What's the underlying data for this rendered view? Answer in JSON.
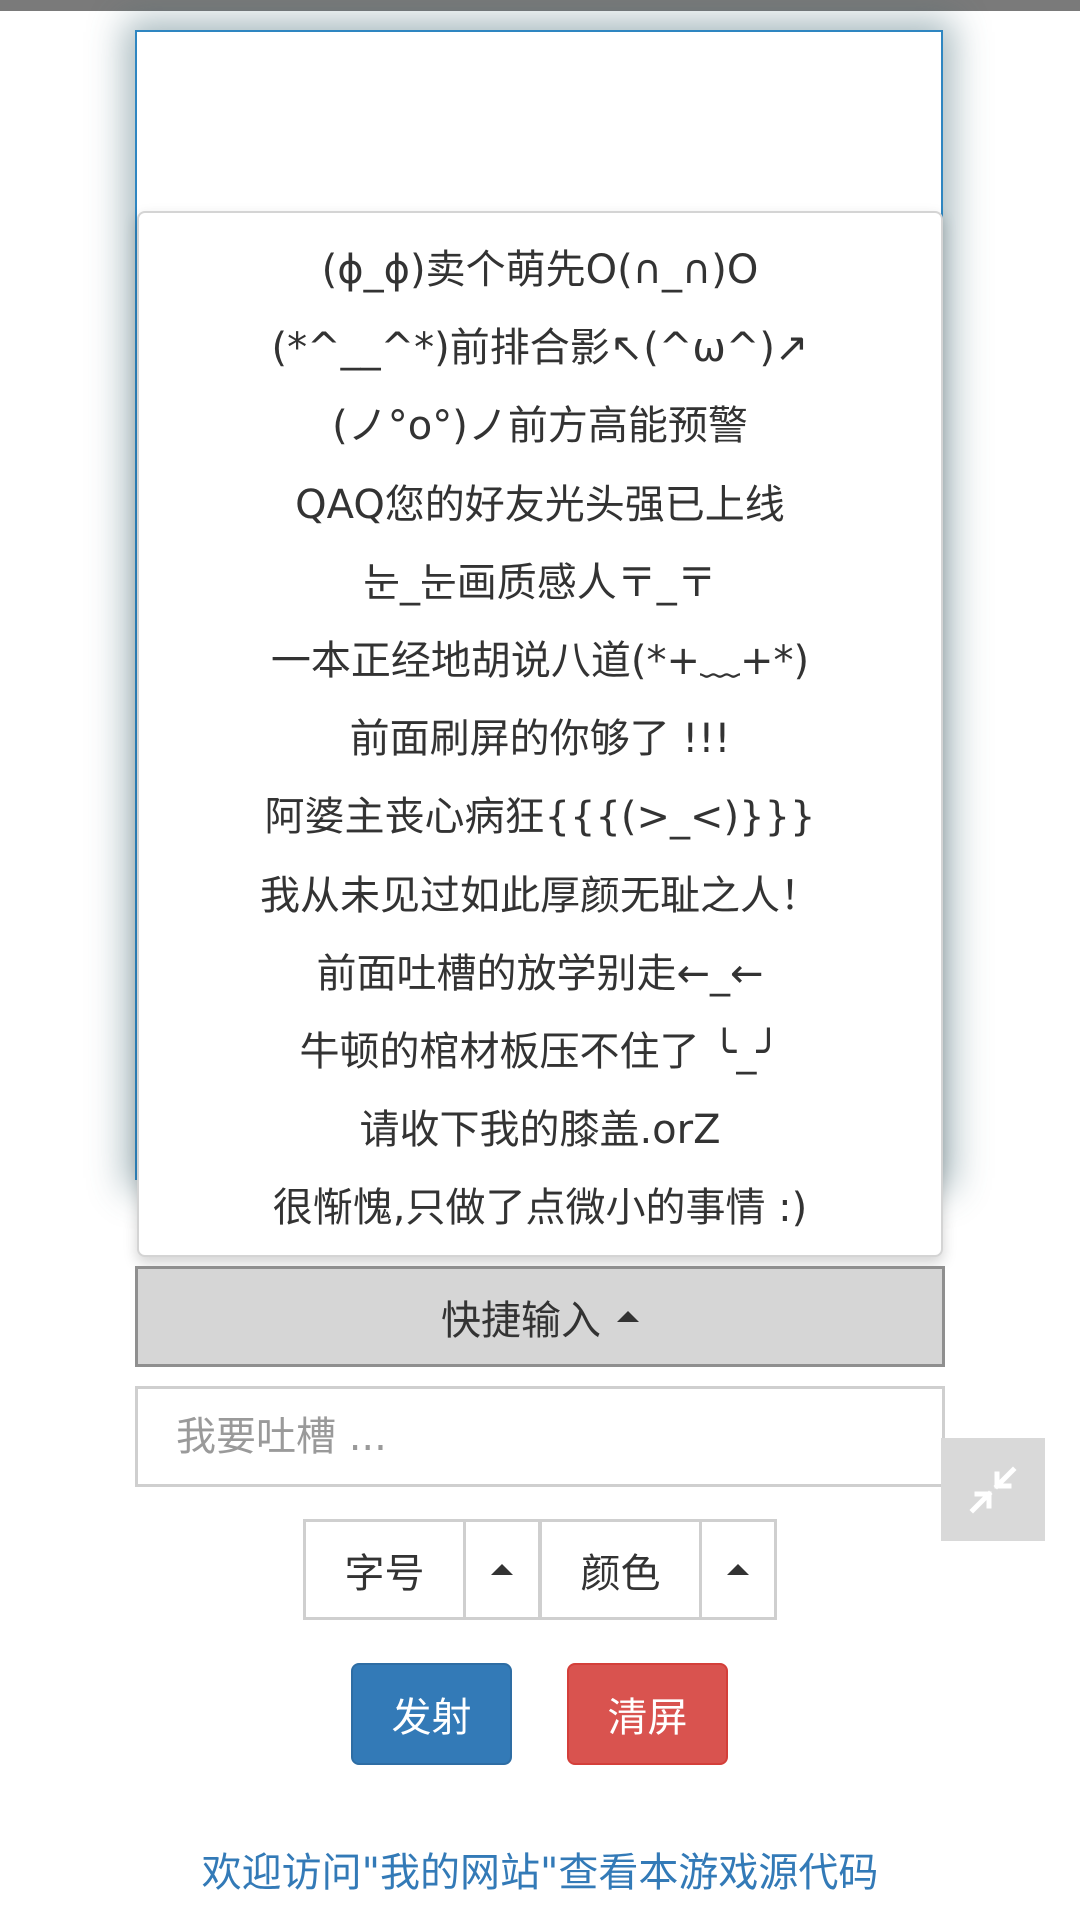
{
  "quick_input": {
    "items": [
      "(ϕ_ϕ)卖个萌先O(∩_∩)O",
      "(*^__^*)前排合影↖(^ω^)↗",
      "(ノ°o°)ノ前方高能预警",
      "QAQ您的好友光头强已上线",
      "눈_눈画质感人〒_〒",
      "一本正经地胡说八道(*+﹏+*)",
      "前面刷屏的你够了 !!!",
      "阿婆主丧心病狂{{{(>_<)}}}",
      "我从未见过如此厚颜无耻之人！",
      "前面吐槽的放学别走←_←",
      "牛顿的棺材板压不住了 ╰_╯",
      "请收下我的膝盖.orZ",
      "很惭愧,只做了点微小的事情 :)"
    ],
    "toggle_label": "快捷输入",
    "toggle_icon": "caret-up-icon"
  },
  "comment": {
    "value": "",
    "placeholder": "我要吐槽 ..."
  },
  "fullscreen": {
    "icon": "exit-fullscreen-icon"
  },
  "font_size": {
    "label": "字号",
    "icon": "caret-up-icon"
  },
  "color_picker": {
    "label": "颜色",
    "icon": "caret-up-icon"
  },
  "actions": {
    "fire_label": "发射",
    "clear_label": "清屏"
  },
  "footer": {
    "link_text": "欢迎访问\"我的网站\"查看本游戏源代码"
  },
  "colors": {
    "primary": "#337ab7",
    "danger": "#d9534f",
    "screen_border": "#2e86c1",
    "toggle_bg": "#d6d6d6"
  }
}
